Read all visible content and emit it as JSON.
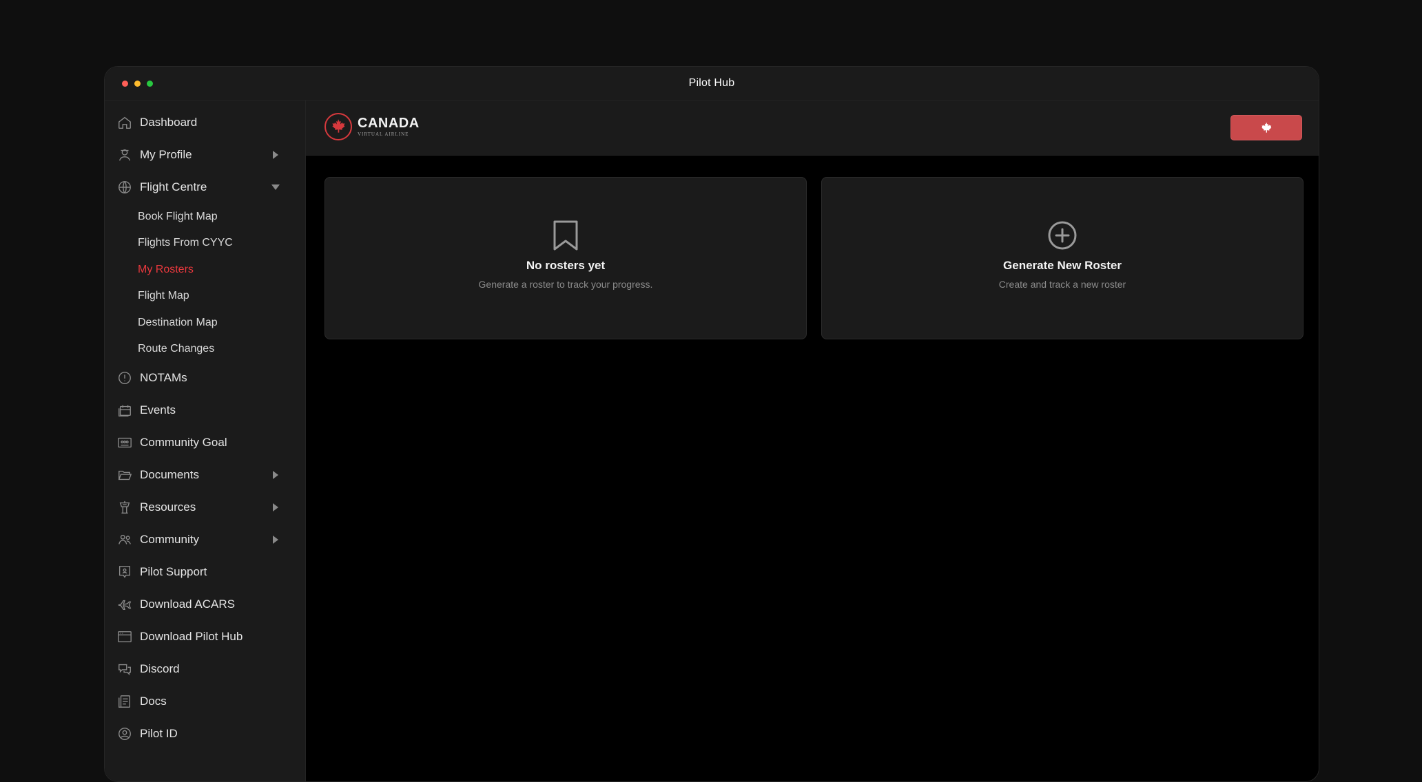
{
  "window": {
    "title": "Pilot Hub"
  },
  "sidebar": {
    "items": [
      {
        "label": "Dashboard"
      },
      {
        "label": "My Profile"
      },
      {
        "label": "Flight Centre"
      },
      {
        "label": "NOTAMs"
      },
      {
        "label": "Events"
      },
      {
        "label": "Community Goal"
      },
      {
        "label": "Documents"
      },
      {
        "label": "Resources"
      },
      {
        "label": "Community"
      },
      {
        "label": "Pilot Support"
      },
      {
        "label": "Download ACARS"
      },
      {
        "label": "Download Pilot Hub"
      },
      {
        "label": "Discord"
      },
      {
        "label": "Docs"
      },
      {
        "label": "Pilot ID"
      }
    ],
    "flight_centre_sub": [
      {
        "label": "Book Flight Map"
      },
      {
        "label": "Flights From CYYC"
      },
      {
        "label": "My Rosters"
      },
      {
        "label": "Flight Map"
      },
      {
        "label": "Destination Map"
      },
      {
        "label": "Route Changes"
      }
    ],
    "active_sub": "My Rosters"
  },
  "header": {
    "logo_main": "CANADA",
    "logo_sub": "VIRTUAL AIRLINE"
  },
  "cards": {
    "empty": {
      "title": "No rosters yet",
      "subtitle": "Generate a roster to track your progress."
    },
    "generate": {
      "title": "Generate New Roster",
      "subtitle": "Create and track a new roster"
    }
  },
  "colors": {
    "accent": "#e8383d",
    "flag_button": "#c9494b",
    "sidebar_bg": "#1b1b1b"
  }
}
